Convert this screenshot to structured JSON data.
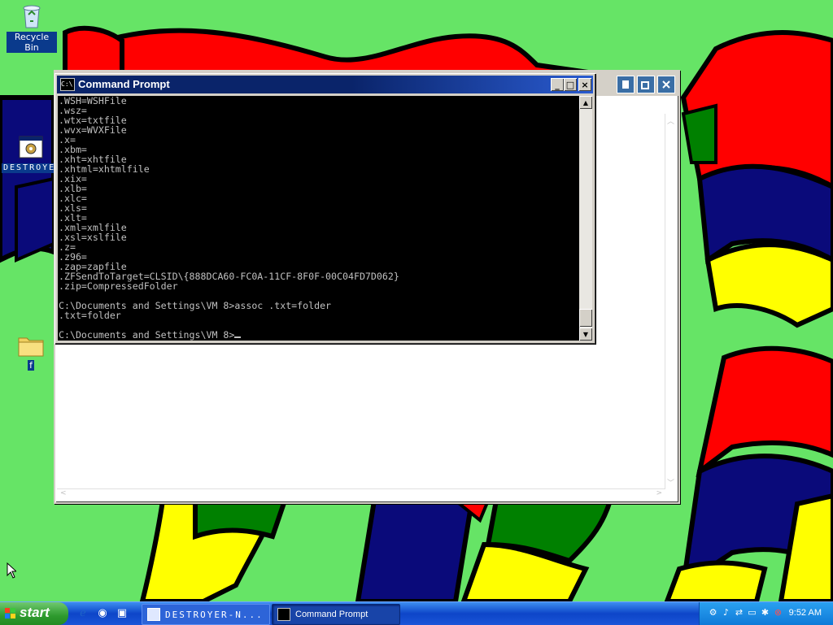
{
  "desktop": {
    "icons": [
      {
        "label": "Recycle Bin"
      },
      {
        "label": "DESTROYER"
      },
      {
        "label": "f"
      }
    ]
  },
  "cmd_window": {
    "title": "Command Prompt",
    "minimize_label": "_",
    "maximize_label": "□",
    "close_label": "×",
    "console_lines": [
      ".WSH=WSHFile",
      ".wsz=",
      ".wtx=txtfile",
      ".wvx=WVXFile",
      ".x=",
      ".xbm=",
      ".xht=xhtfile",
      ".xhtml=xhtmlfile",
      ".xix=",
      ".xlb=",
      ".xlc=",
      ".xls=",
      ".xlt=",
      ".xml=xmlfile",
      ".xsl=xslfile",
      ".z=",
      ".z96=",
      ".zap=zapfile",
      ".ZFSendToTarget=CLSID\\{888DCA60-FC0A-11CF-8F0F-00C04FD7D062}",
      ".zip=CompressedFolder",
      "",
      "C:\\Documents and Settings\\VM 8>assoc .txt=folder",
      ".txt=folder",
      "",
      "C:\\Documents and Settings\\VM 8>"
    ]
  },
  "taskbar": {
    "start_label": "start",
    "tasks": [
      {
        "label": "DESTROYER-N..."
      },
      {
        "label": "Command Prompt"
      }
    ],
    "clock": "9:52 AM"
  },
  "colors": {
    "desktop_green": "#66e466",
    "wave_red": "#ff0000",
    "wave_blue": "#0a0a7a",
    "wave_yellow": "#ffff00",
    "wave_green": "#008000",
    "title_blue": "#0a246a",
    "taskbar_blue": "#0d45c8",
    "start_green": "#2e9a2e"
  }
}
